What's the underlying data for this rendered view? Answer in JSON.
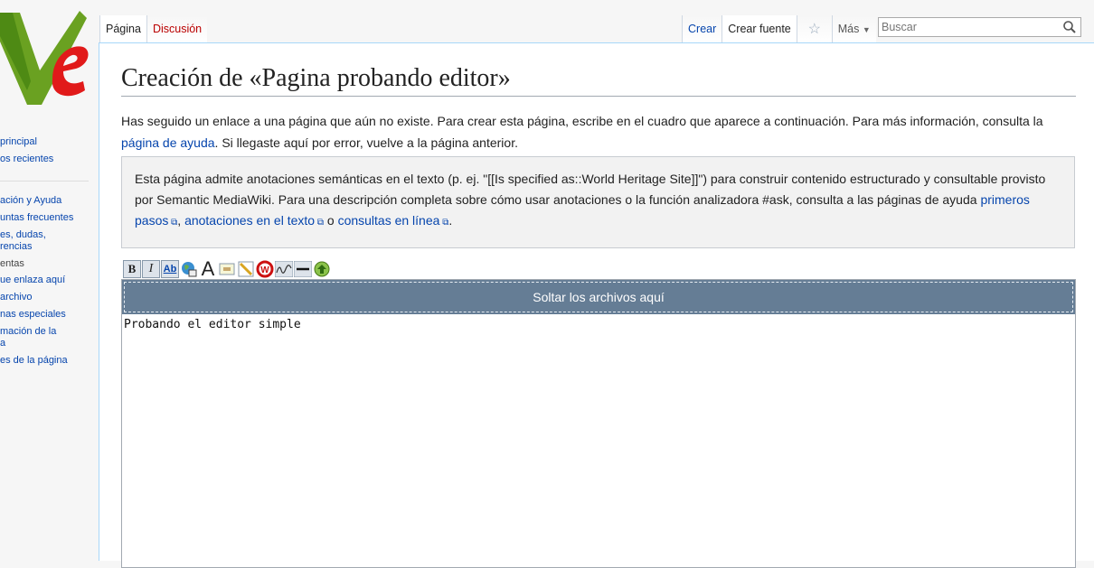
{
  "tabs": {
    "pagina": "Página",
    "discusion": "Discusión",
    "crear": "Crear",
    "crear_fuente": "Crear fuente",
    "mas": "Más"
  },
  "search": {
    "placeholder": "Buscar"
  },
  "sidebar": {
    "items_top": [
      "principal",
      "os recientes"
    ],
    "items_mid": [
      "ación y Ayuda",
      "untas frecuentes",
      "es, dudas,\nrencias"
    ],
    "tools_heading": "entas",
    "tools": [
      "ue enlaza aquí",
      " archivo",
      "nas especiales",
      "mación de la\na",
      "es de la página"
    ]
  },
  "page": {
    "title": "Creación de «Pagina probando editor»",
    "intro_1": "Has seguido un enlace a una página que aún no existe. Para crear esta página, escribe en el cuadro que aparece a continuación. Para más información, consulta la ",
    "intro_link": "página de ayuda",
    "intro_2": ". Si llegaste aquí por error, vuelve a la página anterior."
  },
  "smw_notice": {
    "text_1": "Esta página admite anotaciones semánticas en el texto (p. ej. \"[[Is specified as::World Heritage Site]]\") para construir contenido estructurado y consultable provisto por Semantic MediaWiki. Para una descripción completa sobre cómo usar anotaciones o la función analizadora #ask, consulta a las páginas de ayuda ",
    "link_1": "primeros pasos",
    "sep_1": ", ",
    "link_2": "anotaciones en el texto",
    "sep_2": " o ",
    "link_3": "consultas en línea",
    "end": "."
  },
  "toolbar": {
    "bold": "B",
    "italic": "I",
    "link": "Ab",
    "big_a": "A"
  },
  "editor": {
    "dropzone": "Soltar los archivos aquí",
    "content": "Probando el editor simple"
  },
  "colors": {
    "link": "#0645ad",
    "new_link": "#ba0000",
    "dropzone_bg": "#657d95",
    "logo_green": "#6aa121",
    "logo_red": "#e11a1a"
  }
}
